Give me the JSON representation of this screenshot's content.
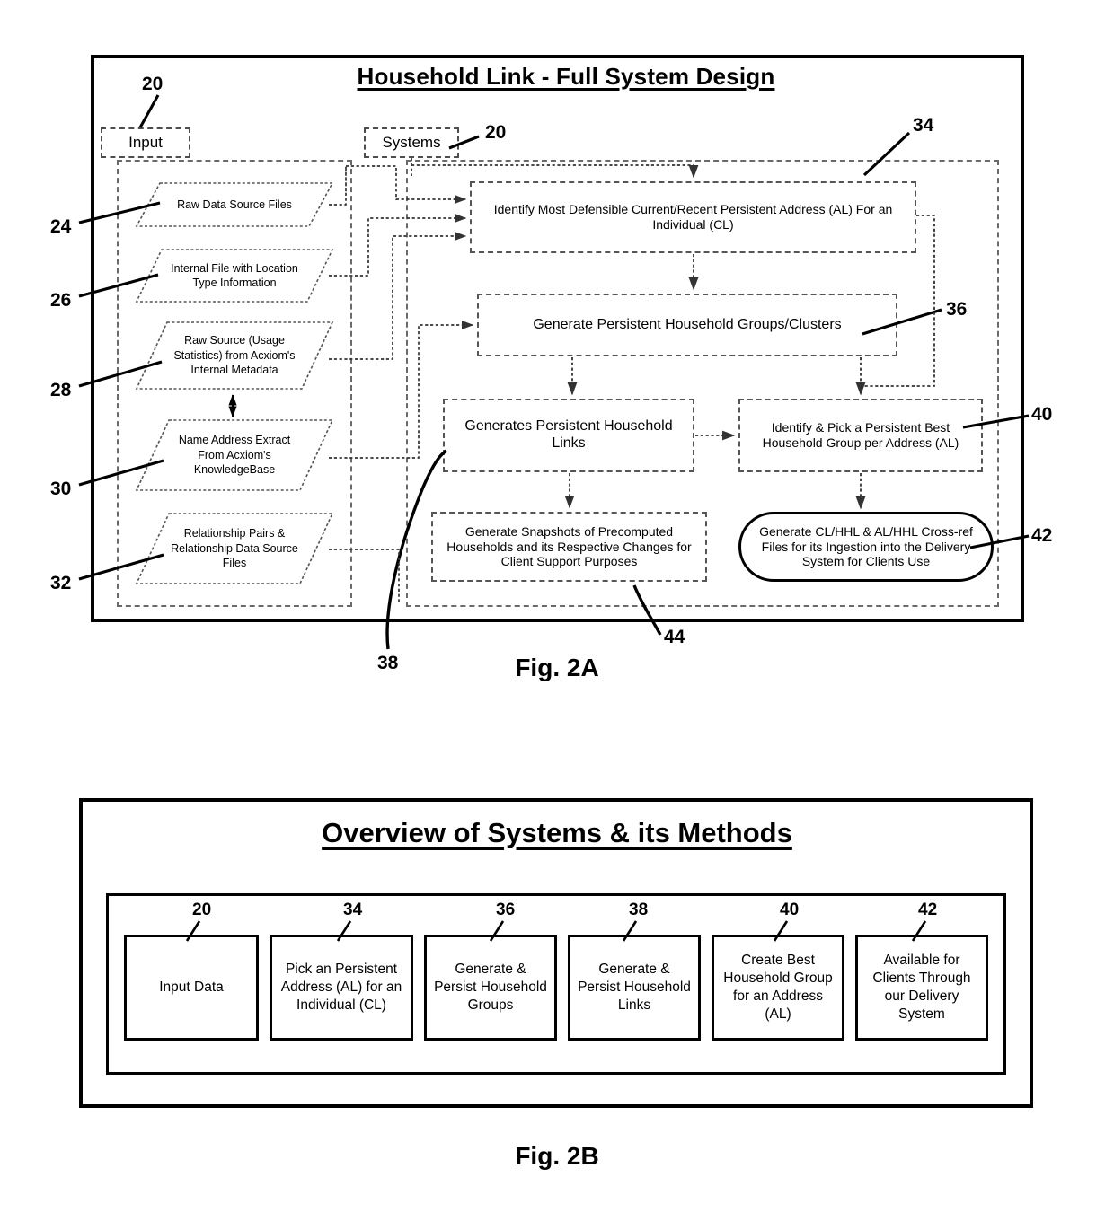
{
  "figures": {
    "fig2a": {
      "caption": "Fig. 2A",
      "title": "Household Link - Full System Design",
      "tags": [
        {
          "id": "input",
          "label": "Input",
          "ref": "20"
        },
        {
          "id": "systems",
          "label": "Systems",
          "ref": "20"
        }
      ],
      "inputs": [
        {
          "ref": "24",
          "label": "Raw Data Source Files"
        },
        {
          "ref": "26",
          "label": "Internal File with Location Type Information"
        },
        {
          "ref": "28",
          "label": "Raw Source (Usage Statistics) from Acxiom's Internal Metadata"
        },
        {
          "ref": "30",
          "label": "Name Address Extract From Acxiom's KnowledgeBase"
        },
        {
          "ref": "32",
          "label": "Relationship Pairs & Relationship Data Source Files"
        }
      ],
      "processes": [
        {
          "ref": "34",
          "label": "Identify Most Defensible Current/Recent Persistent Address (AL) For an Individual (CL)"
        },
        {
          "ref": "36",
          "label": "Generate Persistent Household Groups/Clusters"
        },
        {
          "ref": "38",
          "label": "Generates Persistent Household Links"
        },
        {
          "ref": "40",
          "label": "Identify & Pick a Persistent Best Household Group per Address (AL)"
        },
        {
          "ref": "44",
          "label": "Generate Snapshots of Precomputed Households and its Respective Changes for Client Support Purposes"
        },
        {
          "ref": "42",
          "label": "Generate CL/HHL & AL/HHL Cross-ref Files for its Ingestion into the Delivery System for Clients Use"
        }
      ]
    },
    "fig2b": {
      "caption": "Fig. 2B",
      "title": "Overview of Systems & its Methods",
      "steps": [
        {
          "ref": "20",
          "label": "Input Data"
        },
        {
          "ref": "34",
          "label": "Pick an Persistent Address (AL) for an Individual (CL)"
        },
        {
          "ref": "36",
          "label": "Generate & Persist Household Groups"
        },
        {
          "ref": "38",
          "label": "Generate & Persist Household Links"
        },
        {
          "ref": "40",
          "label": "Create Best Household Group for an Address (AL)"
        },
        {
          "ref": "42",
          "label": "Available for Clients Through our Delivery System"
        }
      ]
    }
  },
  "colors": {
    "line": "#000000",
    "dashed": "#555555",
    "background": "#ffffff"
  }
}
